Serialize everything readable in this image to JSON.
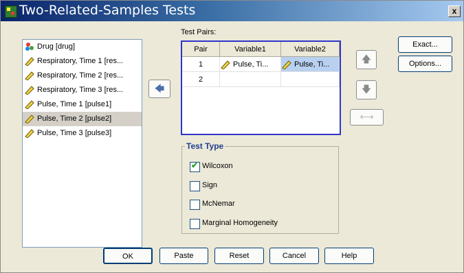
{
  "window": {
    "title": "Two-Related-Samples Tests",
    "close_label": "x"
  },
  "variables": [
    {
      "label": "Drug [drug]",
      "icon": "nominal-icon",
      "selected": false
    },
    {
      "label": "Respiratory, Time 1 [res...",
      "icon": "scale-icon",
      "selected": false
    },
    {
      "label": "Respiratory, Time 2 [res...",
      "icon": "scale-icon",
      "selected": false
    },
    {
      "label": "Respiratory, Time 3 [res...",
      "icon": "scale-icon",
      "selected": false
    },
    {
      "label": "Pulse, Time 1 [pulse1]",
      "icon": "scale-icon",
      "selected": false
    },
    {
      "label": "Pulse, Time 2 [pulse2]",
      "icon": "scale-icon",
      "selected": true
    },
    {
      "label": "Pulse, Time 3 [pulse3]",
      "icon": "scale-icon",
      "selected": false
    }
  ],
  "test_pairs": {
    "label": "Test Pairs:",
    "columns": [
      "Pair",
      "Variable1",
      "Variable2"
    ],
    "rows": [
      {
        "pair": "1",
        "variable1": "Pulse, Ti...",
        "variable2": "Pulse, Ti..."
      },
      {
        "pair": "2",
        "variable1": "",
        "variable2": ""
      }
    ]
  },
  "test_type": {
    "title": "Test Type",
    "options": [
      {
        "label": "Wilcoxon",
        "checked": true
      },
      {
        "label": "Sign",
        "checked": false
      },
      {
        "label": "McNemar",
        "checked": false
      },
      {
        "label": "Marginal Homogeneity",
        "checked": false
      }
    ]
  },
  "side_buttons": {
    "exact": "Exact...",
    "options": "Options..."
  },
  "bottom_buttons": {
    "ok": "OK",
    "paste": "Paste",
    "reset": "Reset",
    "cancel": "Cancel",
    "help": "Help"
  },
  "arrows": {
    "move": "🡄",
    "up": "🡅",
    "down": "🡇",
    "swap": "⟷"
  }
}
